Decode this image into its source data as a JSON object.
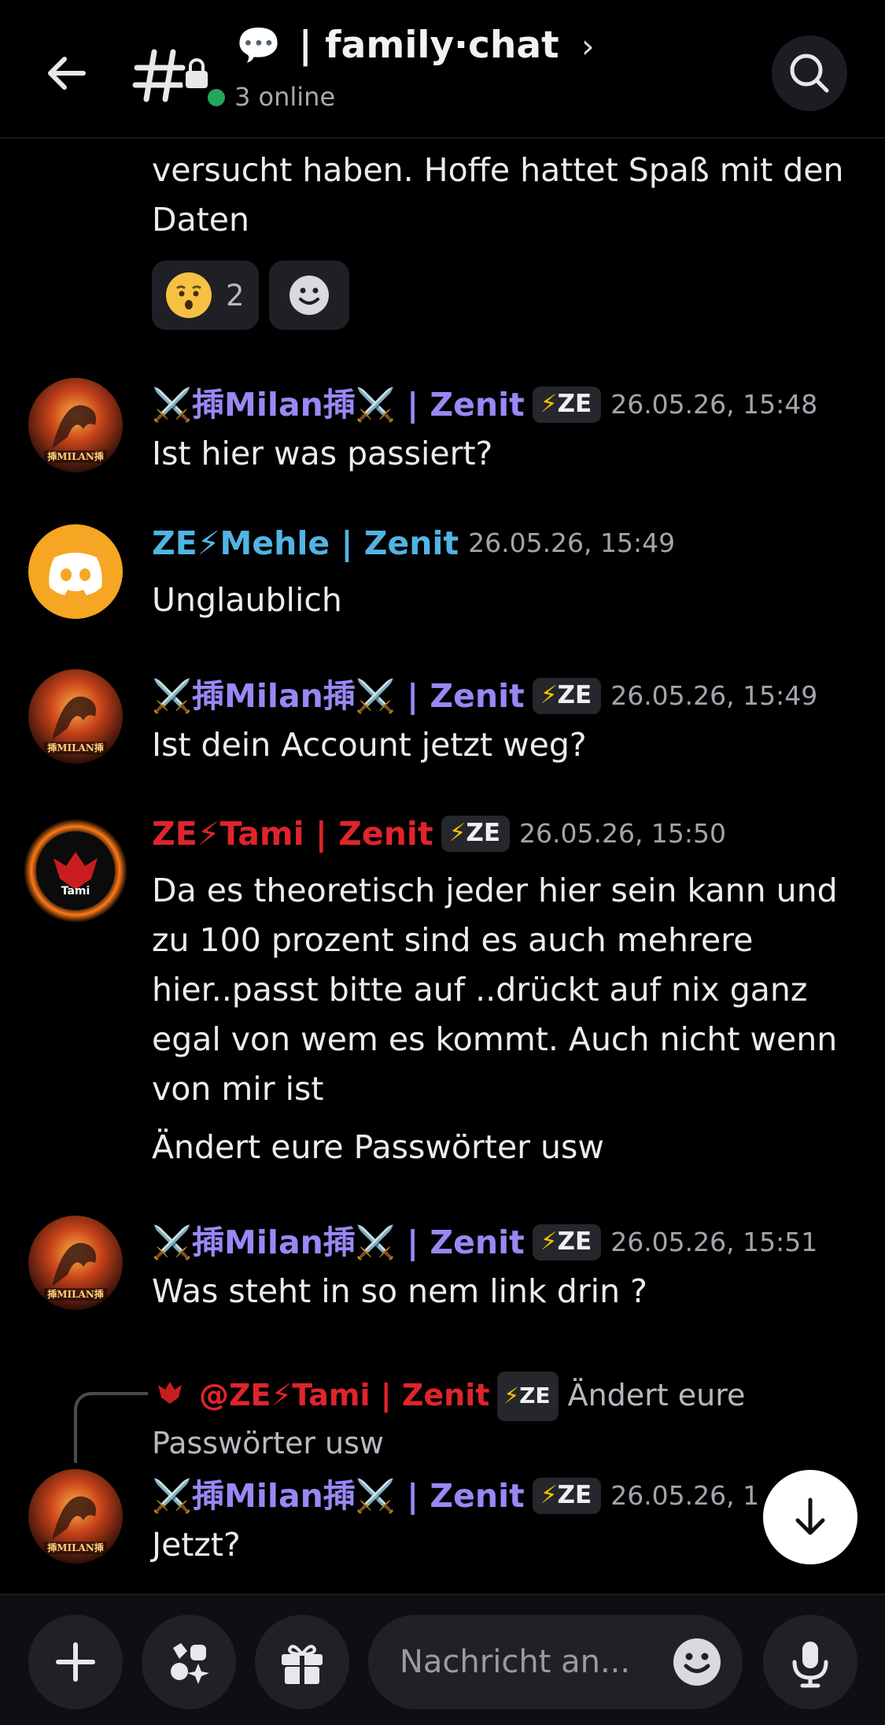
{
  "header": {
    "channel_emoji": "💬",
    "channel_name": "| family·chat",
    "chevron": "›",
    "online_text": "3 online"
  },
  "messages": [
    {
      "continued_text": "versucht haben. Hoffe hattet Spaß mit den Daten",
      "reactions": [
        {
          "emoji": "hushed-face",
          "count": "2"
        },
        {
          "emoji": "add-reaction",
          "count": ""
        }
      ]
    },
    {
      "author": "⚔️揷Milan揷⚔️ | Zenit",
      "author_color": "#9a87f5",
      "tag": "ZE",
      "timestamp": "26.05.26, 15:48",
      "text": "Ist hier was passiert?"
    },
    {
      "author": "ZE⚡Mehle | Zenit",
      "author_color": "#52b4e3",
      "timestamp": "26.05.26, 15:49",
      "text": "Unglaublich"
    },
    {
      "author": "⚔️揷Milan揷⚔️ | Zenit",
      "author_color": "#9a87f5",
      "tag": "ZE",
      "timestamp": "26.05.26, 15:49",
      "text": "Ist dein Account jetzt weg?"
    },
    {
      "author": "ZE⚡Tami | Zenit",
      "author_color": "#e0242b",
      "tag": "ZE",
      "timestamp": "26.05.26, 15:50",
      "text": "Da es theoretisch jeder hier sein kann und zu 100 prozent sind es auch mehrere hier..passt bitte auf ..drückt auf nix ganz egal von wem es kommt. Auch nicht wenn von mir ist",
      "text2": "Ändert eure Passwörter usw"
    },
    {
      "author": "⚔️揷Milan揷⚔️ | Zenit",
      "author_color": "#9a87f5",
      "tag": "ZE",
      "timestamp": "26.05.26, 15:51",
      "text": "Was steht in so nem link drin ?"
    },
    {
      "reply_mention": "@ZE⚡Tami | Zenit",
      "reply_tag": "ZE",
      "reply_text": "Ändert eure Passwörter usw",
      "author": "⚔️揷Milan揷⚔️ | Zenit",
      "author_color": "#9a87f5",
      "tag": "ZE",
      "timestamp": "26.05.26, 1",
      "text": "Jetzt?"
    }
  ],
  "avatars": {
    "milan_label": "揷MILAN揷",
    "tami_label": "Tami"
  },
  "composer": {
    "placeholder": "Nachricht an..."
  },
  "icons": [
    "back-arrow-icon",
    "channel-hash-icon",
    "search-icon",
    "plus-icon",
    "apps-icon",
    "gift-icon",
    "emoji-icon",
    "microphone-icon",
    "arrow-down-icon"
  ],
  "colors": {
    "background": "#000000",
    "online": "#23a55a",
    "discord_avatar": "#f6a623"
  }
}
